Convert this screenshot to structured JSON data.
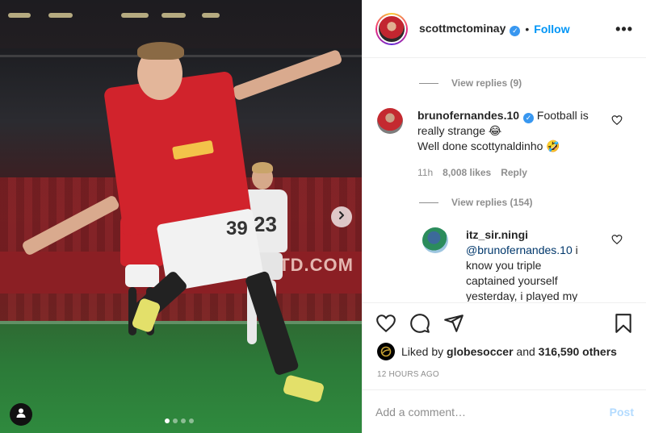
{
  "post": {
    "board_text": "TD.COM",
    "carousel": {
      "total": 4,
      "active": 1
    }
  },
  "header": {
    "username": "scottmctominay",
    "verified": true,
    "separator": "•",
    "follow_label": "Follow",
    "more_label": "•••"
  },
  "comments": {
    "view_replies_top": "View replies (9)",
    "main": {
      "username": "brunofernandes.10",
      "verified": true,
      "line1": "Football is really strange 😂",
      "line2": "Well done scottynaldinho 🤣",
      "time": "11h",
      "likes": "8,008 likes",
      "reply": "Reply"
    },
    "view_replies_main": "View replies (154)",
    "reply": {
      "username": "itz_sir.ningi",
      "mention": "@brunofernandes.10",
      "text": " i know you triple captained yourself yesterday, i played my"
    }
  },
  "actions": {
    "liked_prefix": "Liked by ",
    "liked_user": "globesoccer",
    "liked_mid": " and ",
    "liked_count": "316,590 others",
    "timestamp": "12 HOURS AGO"
  },
  "add_comment": {
    "placeholder": "Add a comment…",
    "post_label": "Post"
  },
  "colors": {
    "accent": "#0095f6",
    "verified": "#3897f0",
    "post_disabled": "#b3dbff",
    "shirt": "#d1232c"
  },
  "icons": [
    "chevron-right-icon",
    "person-tag-icon",
    "more-icon",
    "heart-icon",
    "comment-icon",
    "share-icon",
    "bookmark-icon"
  ]
}
